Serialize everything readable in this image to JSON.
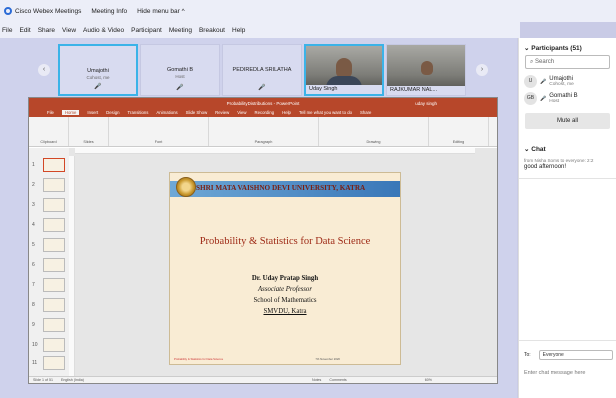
{
  "titlebar": {
    "app": "Cisco Webex Meetings",
    "meeting_info": "Meeting Info",
    "hide_menu": "Hide menu bar ^"
  },
  "menu": [
    "File",
    "Edit",
    "Share",
    "View",
    "Audio & Video",
    "Participant",
    "Meeting",
    "Breakout",
    "Help"
  ],
  "videos": [
    {
      "name": "Umajothi",
      "sub": "Cohost, me"
    },
    {
      "name": "Gomathi B",
      "sub": "Host"
    },
    {
      "name": "PEDIREDLA SRILATHA",
      "sub": ""
    },
    {
      "name": "Uday Singh",
      "sub": ""
    },
    {
      "name": "RAJKUMAR NAL...",
      "sub": ""
    }
  ],
  "ppt": {
    "title": "ProbabilityDistributions - PowerPoint",
    "user": "uday singh",
    "tabs": [
      "File",
      "Home",
      "Insert",
      "Design",
      "Transitions",
      "Animations",
      "Slide Show",
      "Review",
      "View",
      "Recording",
      "Help",
      "Tell me what you want to do",
      "Share"
    ],
    "ribbon_groups": [
      "Clipboard",
      "Slides",
      "Font",
      "Paragraph",
      "Drawing",
      "Editing"
    ],
    "thumb_numbers": [
      "1",
      "2",
      "3",
      "4",
      "5",
      "6",
      "7",
      "8",
      "9",
      "10",
      "11"
    ],
    "status": {
      "slide": "Slide 1 of 51",
      "lang": "English (India)",
      "notes": "Notes",
      "comments": "Comments",
      "zoom": "60%"
    }
  },
  "slide": {
    "university": "SHRI MATA VAISHNO DEVI UNIVERSITY, KATRA",
    "title": "Probability & Statistics for Data Science",
    "name": "Dr. Uday Pratap Singh",
    "role": "Associate Professor",
    "school": "School of Mathematics",
    "place": "SMVDU, Katra",
    "footer_left": "Probability & Statistics for Data Science",
    "footer_right": "7th November 2020"
  },
  "participants": {
    "header": "Participants (51)",
    "search_placeholder": "Search",
    "list": [
      {
        "initials": "U",
        "name": "Umajothi",
        "role": "Cohost, me"
      },
      {
        "initials": "GB",
        "name": "Gomathi B",
        "role": "Host"
      }
    ],
    "mute_all": "Mute all"
  },
  "chat": {
    "header": "Chat",
    "from": "from Nisha Soms to everyone:   2:2",
    "message": "good afternoon!",
    "to_label": "To:",
    "to_value": "Everyone",
    "input_placeholder": "Enter chat message here"
  },
  "colors": {
    "accent": "#3bb3e8",
    "ppt": "#b7472a",
    "slide_title": "#9e2a16"
  }
}
